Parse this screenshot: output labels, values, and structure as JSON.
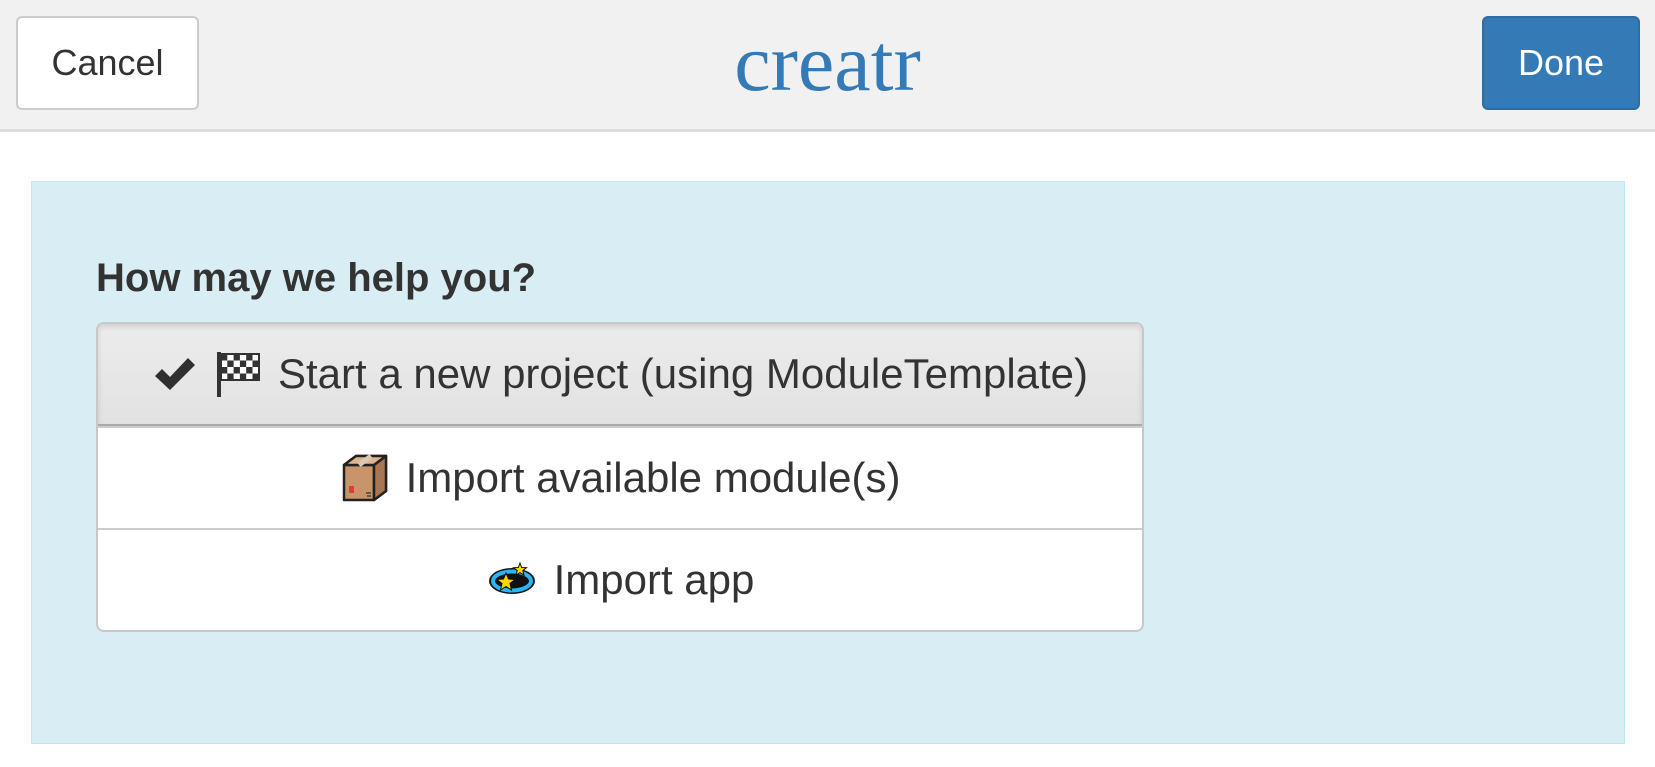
{
  "header": {
    "cancel_label": "Cancel",
    "title": "creatr",
    "done_label": "Done"
  },
  "panel": {
    "question": "How may we help you?",
    "options": [
      {
        "label": "Start a new project (using ModuleTemplate)",
        "icons": [
          "check-icon",
          "checkered-flag-icon"
        ],
        "selected": true
      },
      {
        "label": "Import available module(s)",
        "icons": [
          "package-icon"
        ],
        "selected": false
      },
      {
        "label": "Import app",
        "icons": [
          "ringed-star-icon"
        ],
        "selected": false
      }
    ]
  },
  "colors": {
    "accent": "#337ab7",
    "panel_bg": "#d9edf5",
    "header_bg": "#f1f1f1"
  }
}
